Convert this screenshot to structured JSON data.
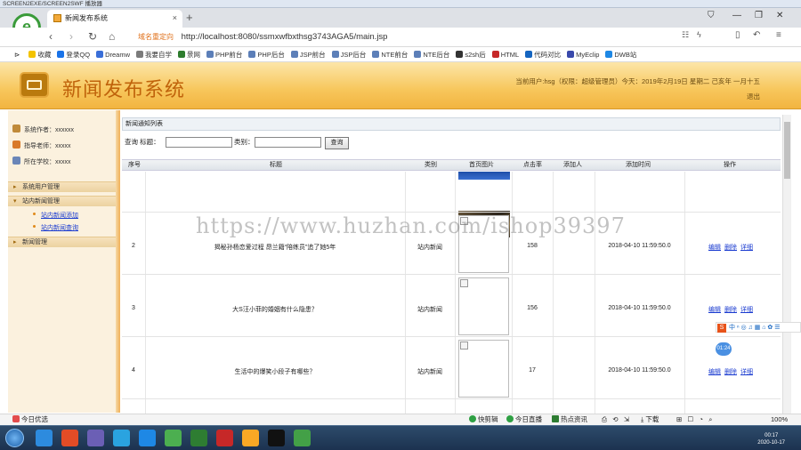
{
  "player": {
    "title": "SCREEN2EXE/SCREEN2SWF 播放器"
  },
  "browser": {
    "tab_title": "新闻发布系统",
    "url_hint": "域名重定向",
    "url": "http://localhost:8080/ssmxwfbxthsg3743AGA5/main.jsp",
    "logo_letter": "e",
    "bookmarks": [
      "收藏",
      "登录QQ",
      "Dreamw",
      "我要自学",
      "景网",
      "PHP前台",
      "PHP后台",
      "JSP前台",
      "JSP后台",
      "NTE前台",
      "NTE后台",
      "s2sh后",
      "HTML",
      "代码对比",
      "MyEclip",
      "DWB站"
    ]
  },
  "app": {
    "title": "新闻发布系统",
    "user_info": "当前用户:hsg（权限：超级管理员）今天：2019年2月19日 星期二 己亥年 一月十五",
    "logout": "退出"
  },
  "sidebar": {
    "info": [
      {
        "label": "系统作者：xxxxxx",
        "icon": "user-icon",
        "color": "#c08a3a"
      },
      {
        "label": "指导老师：xxxxx",
        "icon": "teacher-icon",
        "color": "#d97a2a"
      },
      {
        "label": "所在学校：xxxxx",
        "icon": "school-icon",
        "color": "#6a86b8"
      }
    ],
    "menus": [
      {
        "label": "系统用户管理"
      },
      {
        "label": "站内新闻管理"
      },
      {
        "label": "新闻管理"
      }
    ],
    "submenus": [
      {
        "label": "站内新闻添加"
      },
      {
        "label": "站内新闻查询"
      }
    ]
  },
  "main": {
    "panel_title": "新闻通知列表",
    "search": {
      "title_label": "查询 标题：",
      "type_label": "类别：",
      "button": "查询",
      "title_value": "",
      "type_value": ""
    },
    "columns": [
      "序号",
      "标题",
      "类别",
      "首页图片",
      "点击率",
      "添加人",
      "添加时间",
      "操作"
    ],
    "rows": [
      {
        "no": "2",
        "title": "揭秘孙杨恋爱过程 昂兰籍“陪练员”追了她5年",
        "type": "站内新闻",
        "clicks": "158",
        "adder": "",
        "time": "2018-04-10 11:59:50.0"
      },
      {
        "no": "3",
        "title": "大S汪小菲的婚姻有什么隐患？",
        "type": "站内新闻",
        "clicks": "156",
        "adder": "",
        "time": "2018-04-10 11:59:50.0"
      },
      {
        "no": "4",
        "title": "生活中的爆笑小段子有哪些？",
        "type": "站内新闻",
        "clicks": "17",
        "adder": "",
        "time": "2018-04-10 11:59:50.0"
      }
    ],
    "actions": [
      "编辑",
      "删除",
      "详细"
    ]
  },
  "watermark": "https://www.huzhan.com/ishop39397",
  "ime": {
    "label": "中",
    "badge": "01:24"
  },
  "statusbar": {
    "left": "今日优选",
    "items": [
      "快剪辑",
      "今日直播",
      "热点资讯"
    ],
    "download": "下载",
    "zoom": "100%"
  },
  "taskbar": {
    "time": "00:17",
    "date": "2020-10-17",
    "icon_colors": [
      "#2d8bde",
      "#e34c26",
      "#6b5fb5",
      "#2aa3e0",
      "#1e88e5",
      "#4caf50",
      "#2e7d32",
      "#c62828",
      "#f9a825",
      "#111111",
      "#43a047"
    ]
  }
}
